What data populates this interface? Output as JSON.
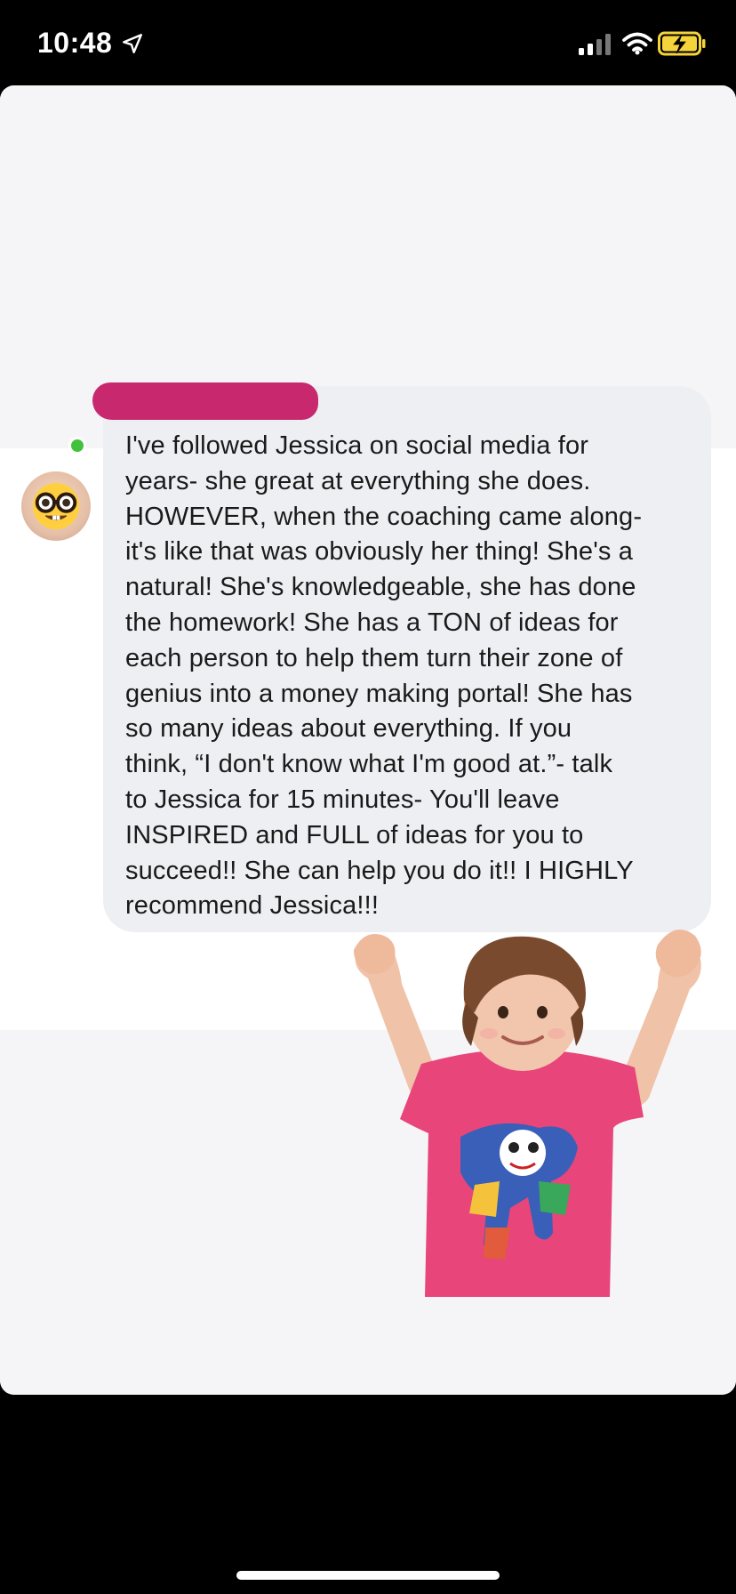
{
  "status_bar": {
    "time": "10:48",
    "icons": [
      "location-arrow-icon",
      "signal-icon",
      "wifi-icon",
      "battery-charging-icon"
    ],
    "battery_color": "#f5d33b"
  },
  "message": {
    "sender_avatar": "nerd-face-emoji-avatar",
    "online_status_color": "#42c23a",
    "redaction_color": "#c8286e",
    "lines": [
      "I've followed Jessica on social media for",
      "years- she great at everything she does.",
      "HOWEVER, when the coaching came along-",
      "it's like that was obviously her thing! She's a",
      "natural! She's knowledgeable, she has done",
      "the homework! She has a TON of ideas for",
      "each person to help them turn their zone of",
      "genius into a money making portal! She has",
      "so many ideas about everything. If you",
      "think, “I don't know what I'm good at.”- talk",
      "to Jessica for 15 minutes- You'll leave",
      "INSPIRED and FULL of ideas  for you to",
      "succeed!! She can help you do it!! I HIGHLY",
      "recommend Jessica!!!"
    ]
  },
  "sticker": {
    "description_icon": "cheering-child-sticker",
    "shirt_color": "#e8457a"
  }
}
